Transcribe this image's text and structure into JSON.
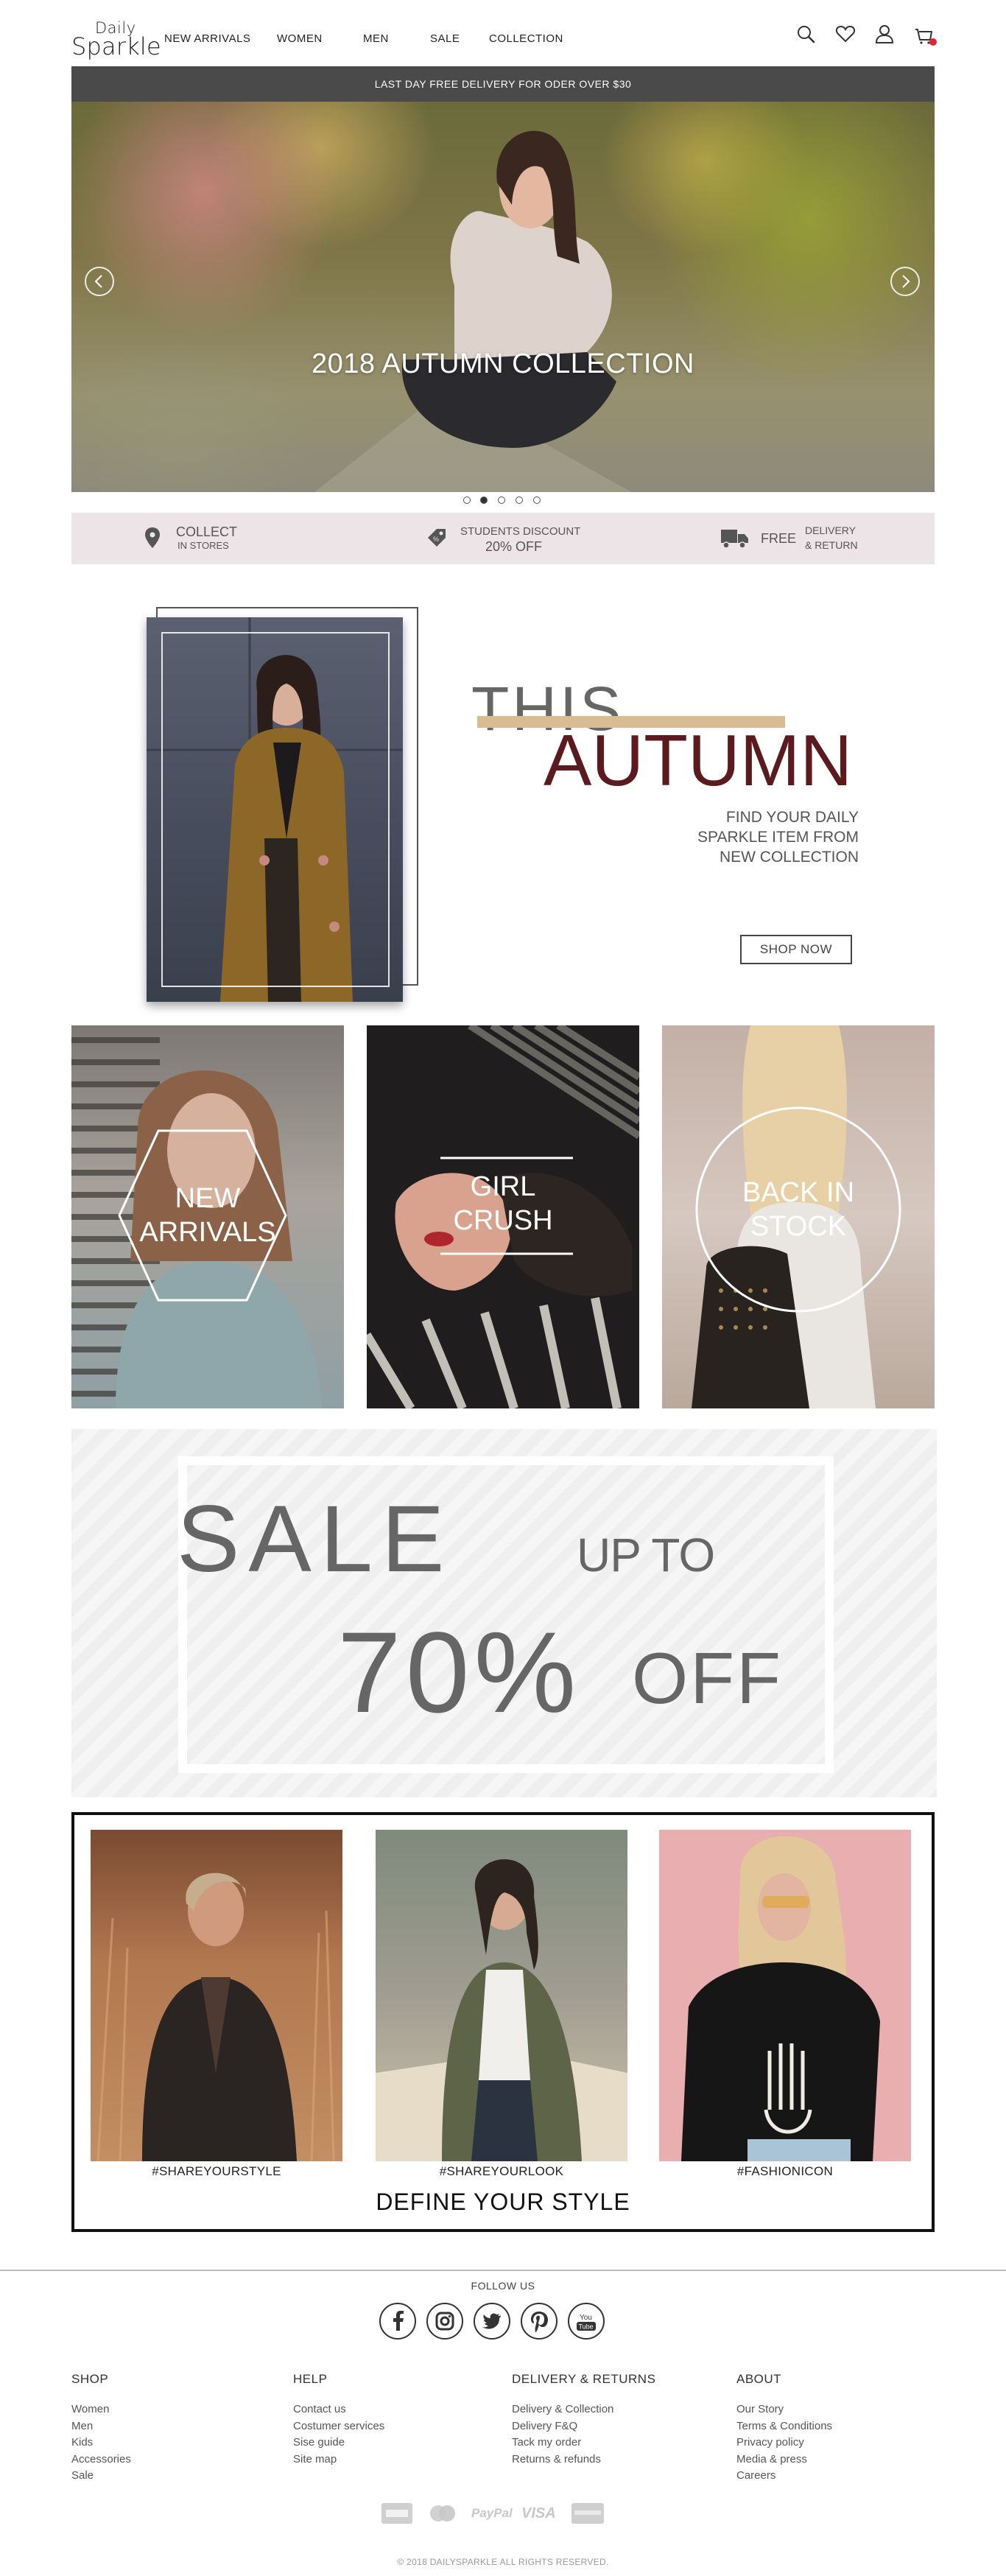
{
  "header": {
    "logo_top": "Daily",
    "logo_bottom": "Sparkle",
    "nav": [
      "NEW ARRIVALS",
      "WOMEN",
      "MEN",
      "SALE",
      "COLLECTION"
    ]
  },
  "promo_bar": "LAST DAY FREE DELIVERY FOR ODER OVER $30",
  "hero": {
    "title": "2018 AUTUMN COLLECTION",
    "slide_count": 5,
    "active_slide": 2
  },
  "features": {
    "collect_main": "COLLECT",
    "collect_sub": "IN STORES",
    "students_main": "STUDENTS DISCOUNT",
    "students_sub": "20% OFF",
    "free_main": "FREE",
    "free_sub1": "DELIVERY",
    "free_sub2": "& RETURN"
  },
  "autumn": {
    "this": "THIS",
    "autumn": "AUTUMN",
    "text1": "FIND YOUR DAILY",
    "text2": "SPARKLE ITEM FROM",
    "text3": "NEW COLLECTION",
    "button": "SHOP NOW"
  },
  "tiles": [
    {
      "line1": "NEW",
      "line2": "ARRIVALS"
    },
    {
      "line1": "GIRL",
      "line2": "CRUSH"
    },
    {
      "line1": "BACK IN",
      "line2": "STOCK"
    }
  ],
  "sale": {
    "word": "SALE",
    "upto": "UP TO",
    "percent": "70%",
    "off": "OFF"
  },
  "style": {
    "tags": [
      "#SHAREYOURSTYLE",
      "#SHAREYOURLOOK",
      "#FASHIONICON"
    ],
    "title": "DEFINE YOUR STYLE"
  },
  "footer": {
    "follow": "FOLLOW US",
    "social": [
      "facebook-icon",
      "instagram-icon",
      "twitter-icon",
      "pinterest-icon",
      "youtube-icon"
    ],
    "youtube_label": "You",
    "youtube_label2": "Tube",
    "columns": [
      {
        "title": "SHOP",
        "items": [
          "Women",
          "Men",
          "Kids",
          "Accessories",
          "Sale"
        ]
      },
      {
        "title": "HELP",
        "items": [
          "Contact us",
          "Costumer services",
          "Sise guide",
          "Site map"
        ]
      },
      {
        "title": "DELIVERY & RETURNS",
        "items": [
          "Delivery & Collection",
          "Delivery F&Q",
          "Tack my order",
          "Returns & refunds"
        ]
      },
      {
        "title": "ABOUT",
        "items": [
          "Our Story",
          "Terms & Conditions",
          "Privacy policy",
          "Media & press",
          "Careers"
        ]
      }
    ],
    "payments": {
      "paypal": "PayPal",
      "visa": "VISA"
    },
    "copyright": "© 2018 DAILYSPARKLE ALL RIGHTS RESERVED."
  }
}
